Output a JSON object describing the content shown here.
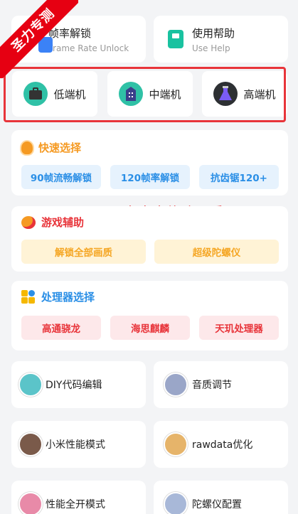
{
  "ribbon": "圣力专测",
  "top_cards": [
    {
      "title": "帧率解锁",
      "subtitle": "Frame Rate Unlock",
      "icon": "blue-square-icon"
    },
    {
      "title": "使用帮助",
      "subtitle": "Use Help",
      "icon": "green-book-icon"
    }
  ],
  "tiers": [
    {
      "label": "低端机",
      "icon": "briefcase-icon"
    },
    {
      "label": "中端机",
      "icon": "building-icon"
    },
    {
      "label": "高端机",
      "icon": "flask-icon"
    }
  ],
  "quick_select": {
    "title": "快速选择",
    "title_color": "#f59a23",
    "buttons": [
      "90帧流畅解锁",
      "120帧率解锁",
      "抗齿锯120+"
    ]
  },
  "overlay_text": "圣力点击修改画质",
  "game_assist": {
    "title": "游戏辅助",
    "title_color": "#e8343a",
    "buttons": [
      "解锁全部画质",
      "超级陀螺仪"
    ]
  },
  "processor": {
    "title": "处理器选择",
    "title_color": "#2b8fe6",
    "buttons": [
      "高通骁龙",
      "海思麒麟",
      "天玑处理器"
    ]
  },
  "tools": [
    {
      "label": "DIY代码编辑",
      "avatar_color": "#5bc4c9"
    },
    {
      "label": "音质调节",
      "avatar_color": "#9aa6c8"
    },
    {
      "label": "小米性能模式",
      "avatar_color": "#7a5a4a"
    },
    {
      "label": "rawdata优化",
      "avatar_color": "#e6b46a"
    },
    {
      "label": "性能全开模式",
      "avatar_color": "#e88aa8"
    },
    {
      "label": "陀螺仪配置",
      "avatar_color": "#a8b8d8"
    }
  ]
}
